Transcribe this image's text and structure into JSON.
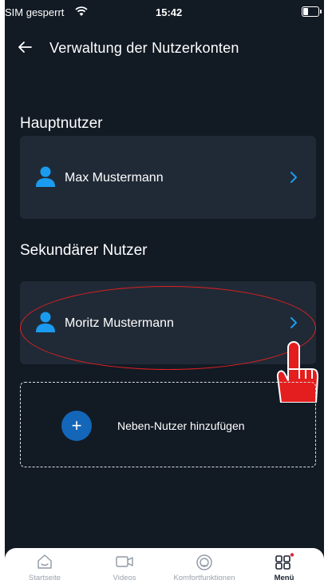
{
  "status_bar": {
    "carrier": "SIM gesperrt",
    "time": "15:42"
  },
  "header": {
    "title": "Verwaltung der Nutzerkonten"
  },
  "main_user": {
    "section_title": "Hauptnutzer",
    "name": "Max Mustermann"
  },
  "secondary_user": {
    "section_title": "Sekundärer Nutzer",
    "name": "Moritz Mustermann"
  },
  "add_user": {
    "label": "Neben-Nutzer hinzufügen"
  },
  "bottom_nav": {
    "items": [
      {
        "label": "Startseite",
        "icon": "home-icon"
      },
      {
        "label": "Videos",
        "icon": "video-icon"
      },
      {
        "label": "Komfortfunktionen",
        "icon": "comfort-icon"
      },
      {
        "label": "Menü",
        "icon": "menu-grid-icon",
        "active": true
      }
    ]
  },
  "colors": {
    "background": "#121a24",
    "card": "#202a36",
    "accent": "#1a9bf0",
    "plus_button": "#1466b8",
    "highlight": "#e02020",
    "notification_dot": "#e0243a"
  }
}
